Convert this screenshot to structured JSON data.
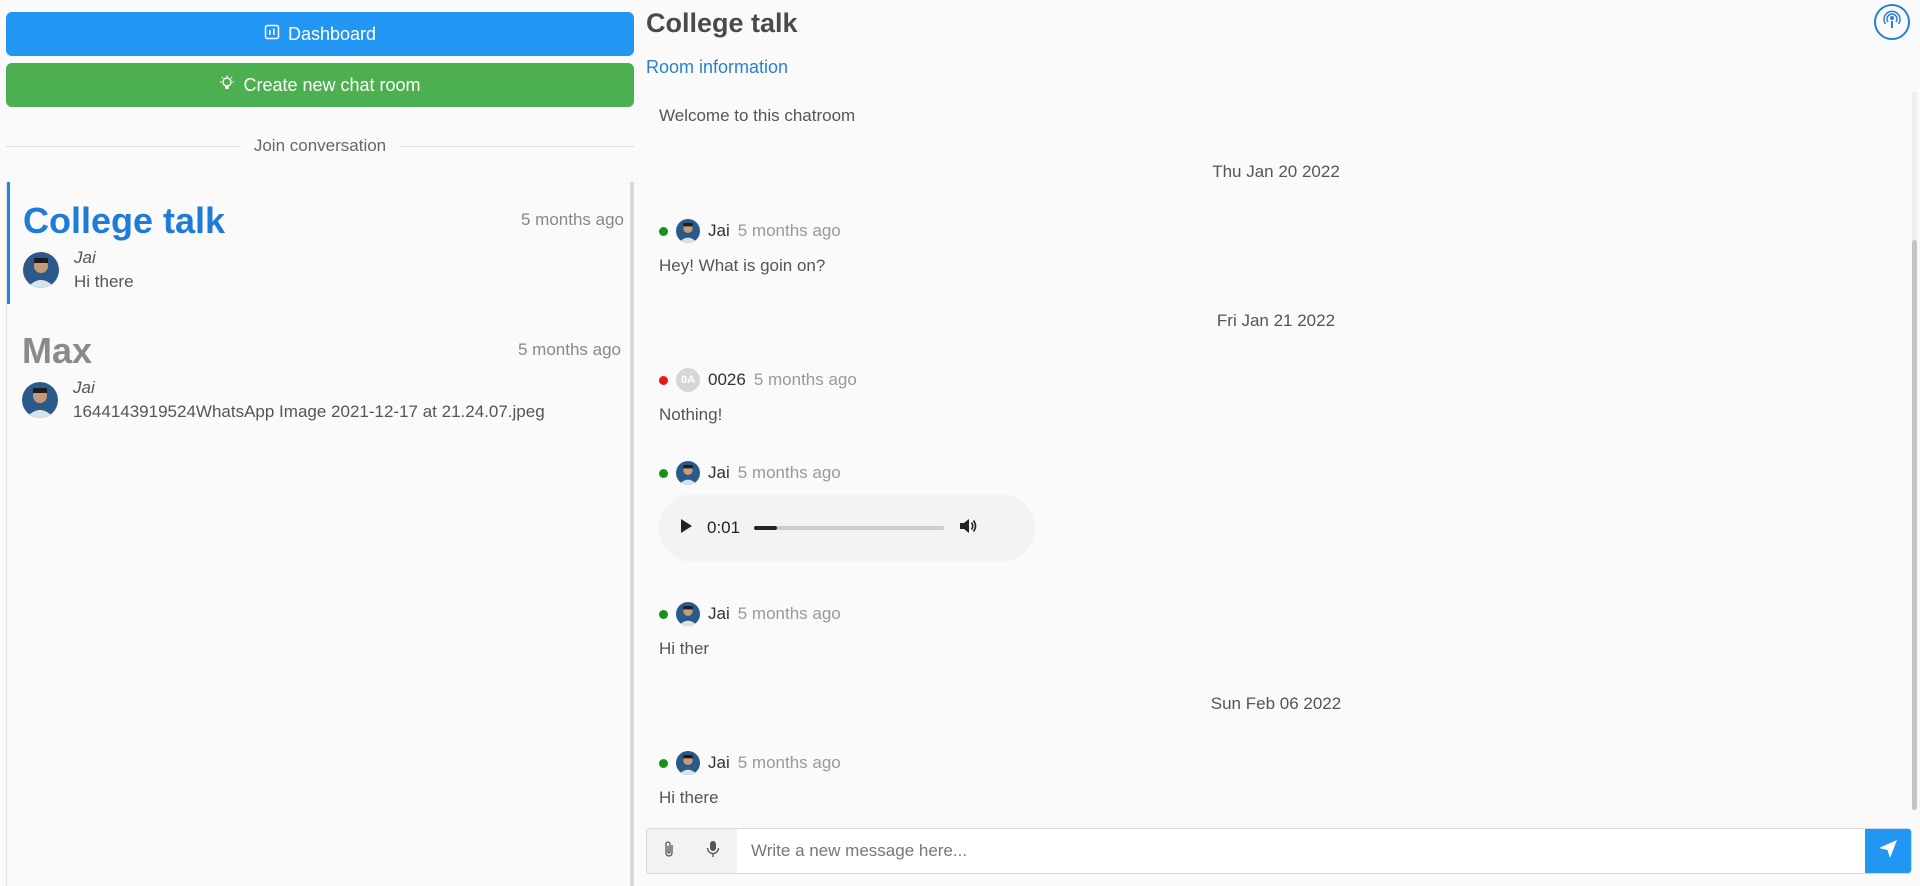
{
  "sidebar": {
    "dashboard_label": "Dashboard",
    "create_room_label": "Create new chat room",
    "join_label": "Join conversation",
    "conversations": [
      {
        "title": "College talk",
        "time": "5 months ago",
        "author": "Jai",
        "last_message": "Hi there"
      },
      {
        "title": "Max",
        "time": "5 months ago",
        "author": "Jai",
        "last_message": "1644143919524WhatsApp Image 2021-12-17 at 21.24.07.jpeg"
      }
    ]
  },
  "room": {
    "title": "College talk",
    "info_link": "Room information"
  },
  "chat": {
    "welcome": "Welcome to this chatroom",
    "dates": [
      "Thu Jan 20 2022",
      "Fri Jan 21 2022",
      "Sun Feb 06 2022"
    ],
    "messages": [
      {
        "user": "Jai",
        "time": "5 months ago",
        "status": "online",
        "text": "Hey! What is goin on?"
      },
      {
        "user": "0026",
        "initials": "0A",
        "time": "5 months ago",
        "status": "offline",
        "text": "Nothing!"
      },
      {
        "user": "Jai",
        "time": "5 months ago",
        "status": "online",
        "audio_time": "0:01",
        "audio_progress": 0.12
      },
      {
        "user": "Jai",
        "time": "5 months ago",
        "status": "online",
        "text": "Hi ther"
      },
      {
        "user": "Jai",
        "time": "5 months ago",
        "status": "online",
        "text": "Hi there"
      }
    ]
  },
  "composer": {
    "placeholder": "Write a new message here..."
  },
  "icons": {
    "dashboard": "dashboard-icon",
    "create": "lightbulb-icon",
    "broadcast": "podcast-icon",
    "attach": "paperclip-icon",
    "mic": "microphone-icon",
    "send": "send-icon",
    "play": "play-icon",
    "volume": "volume-icon"
  },
  "colors": {
    "primary": "#2196f3",
    "success": "#4caf50",
    "link": "#2a7fd4",
    "online": "#1a8f1a",
    "offline": "#e31b1b"
  }
}
